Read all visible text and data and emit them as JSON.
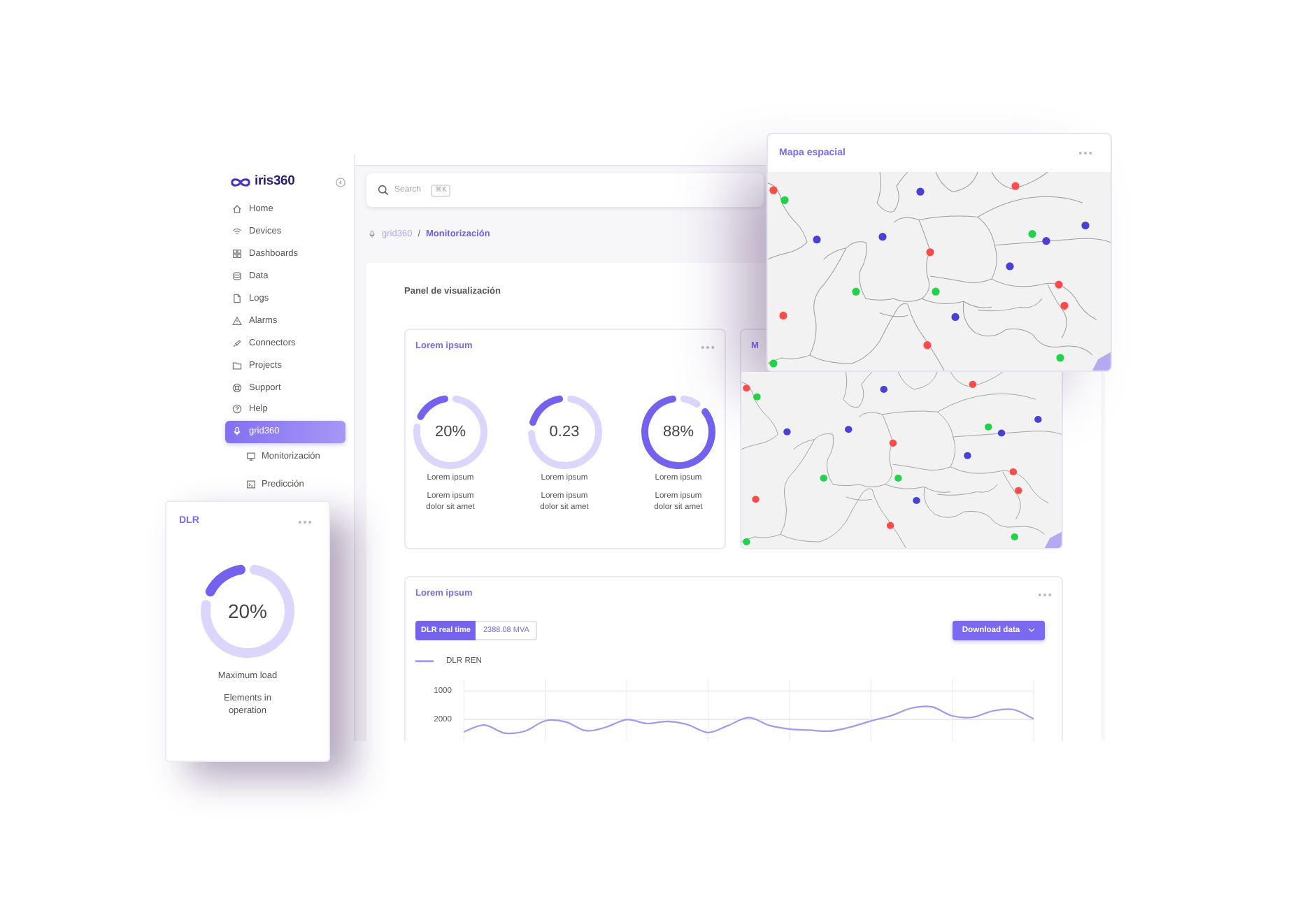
{
  "map_overlay": {
    "title": "Mapa espacial",
    "markers": [
      {
        "color": "#ff4a4a"
      },
      {
        "color": "#1fd446"
      },
      {
        "color": "#4a3fd8"
      },
      {
        "color": "#ff4a4a"
      },
      {
        "color": "#4a3fd8"
      },
      {
        "color": "#4a3fd8"
      },
      {
        "color": "#ff4a4a"
      },
      {
        "color": "#1fd446"
      },
      {
        "color": "#4a3fd8"
      },
      {
        "color": "#4a3fd8"
      },
      {
        "color": "#4a3fd8"
      },
      {
        "color": "#1fd446"
      },
      {
        "color": "#1fd446"
      },
      {
        "color": "#ff4a4a"
      },
      {
        "color": "#ff4a4a"
      },
      {
        "color": "#ff4a4a"
      },
      {
        "color": "#4a3fd8"
      },
      {
        "color": "#ff4a4a"
      },
      {
        "color": "#1fd446"
      },
      {
        "color": "#1fd446"
      }
    ]
  },
  "sidebar": {
    "logo": "iris360",
    "items": [
      {
        "label": "Home",
        "selected": false
      },
      {
        "label": "Devices",
        "selected": false
      },
      {
        "label": "Dashboards",
        "selected": false
      },
      {
        "label": "Data",
        "selected": false
      },
      {
        "label": "Logs",
        "selected": false
      },
      {
        "label": "Alarms",
        "selected": false
      },
      {
        "label": "Connectors",
        "selected": false
      },
      {
        "label": "Projects",
        "selected": false
      },
      {
        "label": "Support",
        "selected": false
      },
      {
        "label": "Help",
        "selected": false
      },
      {
        "label": "grid360",
        "selected": true,
        "children": [
          {
            "label": "Monitorización",
            "selected": false
          },
          {
            "label": "Predicción",
            "selected": false
          }
        ]
      }
    ]
  },
  "search": {
    "placeholder": "Search",
    "shortcut": "⌘K"
  },
  "breadcrumb": {
    "separator": "/",
    "items": [
      {
        "label": "grid360",
        "selected": false
      },
      {
        "label": "Monitorización",
        "selected": true
      }
    ]
  },
  "panel": {
    "title": "Panel de visualización",
    "gauge_card": {
      "title": "Lorem ipsum",
      "gauges": [
        {
          "value": "20%",
          "level": 0.2,
          "label": "Lorem ipsum",
          "description": "Lorem ipsum dolor sit amet"
        },
        {
          "value": "0.23",
          "level": 0.23,
          "label": "Lorem ipsum",
          "description": "Lorem ipsum dolor sit amet"
        },
        {
          "value": "88%",
          "level": 0.88,
          "label": "Lorem ipsum",
          "description": "Lorem ipsum dolor sit amet"
        }
      ]
    },
    "map_card": {
      "title": "M",
      "markers": [
        {
          "color": "#ff4a4a"
        },
        {
          "color": "#1fd446"
        },
        {
          "color": "#4a3fd8"
        },
        {
          "color": "#ff4a4a"
        },
        {
          "color": "#4a3fd8"
        },
        {
          "color": "#4a3fd8"
        },
        {
          "color": "#ff4a4a"
        },
        {
          "color": "#1fd446"
        },
        {
          "color": "#4a3fd8"
        },
        {
          "color": "#4a3fd8"
        },
        {
          "color": "#4a3fd8"
        },
        {
          "color": "#1fd446"
        },
        {
          "color": "#1fd446"
        },
        {
          "color": "#ff4a4a"
        },
        {
          "color": "#ff4a4a"
        },
        {
          "color": "#ff4a4a"
        },
        {
          "color": "#4a3fd8"
        },
        {
          "color": "#ff4a4a"
        },
        {
          "color": "#1fd446"
        },
        {
          "color": "#1fd446"
        }
      ]
    },
    "chart_card": {
      "title": "Lorem ipsum",
      "reading": {
        "label": "DLR real time",
        "value": "2388.08 MVA"
      },
      "button": "Download data",
      "chart_data": {
        "type": "line",
        "grid": true,
        "categories": [
          null,
          null,
          null,
          null,
          null,
          null,
          null,
          null,
          null,
          null,
          null,
          null,
          null,
          null,
          null,
          null,
          null,
          null,
          null,
          null,
          null,
          null,
          null,
          null,
          null,
          null,
          null,
          null,
          null
        ],
        "ylim": [
          2700,
          650
        ],
        "yticks": [
          {
            "value": 1000,
            "label": "1000"
          },
          {
            "value": 2000,
            "label": "2000"
          }
        ],
        "series": [
          {
            "name": "DLR REN",
            "color": "#a597f7",
            "values": [
              2430,
              2190,
              2470,
              2400,
              2040,
              2080,
              2390,
              2260,
              2000,
              2140,
              2060,
              2180,
              2450,
              2200,
              1930,
              2200,
              2330,
              2370,
              2400,
              2260,
              2050,
              1860,
              1600,
              1560,
              1870,
              1920,
              1700,
              1650,
              1980
            ]
          }
        ]
      }
    }
  },
  "dlr_card": {
    "title": "DLR",
    "gauge": {
      "value": "20%",
      "level": 0.2,
      "label": "Maximum load",
      "description": "Elements in operation"
    }
  }
}
